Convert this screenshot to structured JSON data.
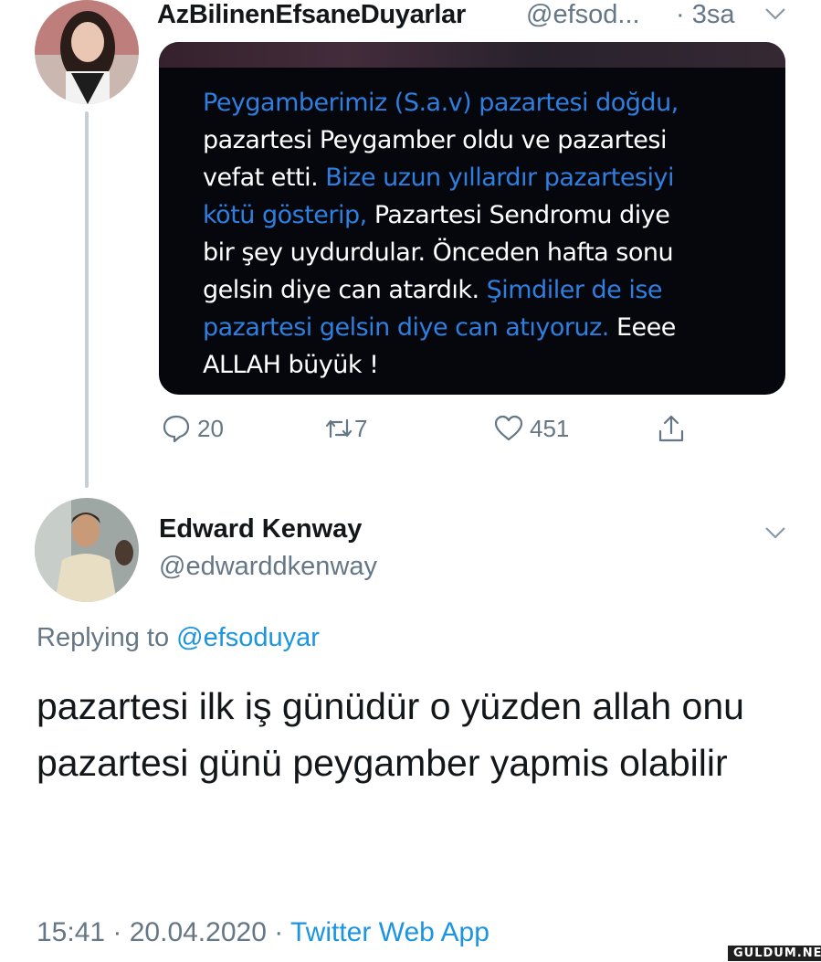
{
  "tweet1": {
    "display_name": "AzBilinenEfsaneDuyarlar",
    "handle": "@efsod...",
    "time": "· 3sa",
    "image_text": {
      "l1": "Peygamberimiz (S.a.v) pazartesi doğdu,",
      "l2": "pazartesi Peygamber oldu ve pazartesi",
      "l3a": "vefat etti. ",
      "l3b": "Bize uzun yıllardır pazartesiyi",
      "l4a": "kötü gösterip, ",
      "l4b": "Pazartesi Sendromu diye",
      "l5": "bir şey uydurdular. Önceden hafta sonu",
      "l6a": "gelsin diye can atardık. ",
      "l6b": "Şimdiler de ise",
      "l7a": "pazartesi gelsin diye can atıyoruz. ",
      "l7b": "Eeee",
      "l8": "ALLAH büyük !"
    },
    "actions": {
      "replies": "20",
      "retweets": "7",
      "likes": "451"
    }
  },
  "tweet2": {
    "display_name": "Edward Kenway",
    "handle": "@edwarddkenway",
    "replying_prefix": "Replying to ",
    "replying_to": "@efsoduyar",
    "text": "pazartesi ilk iş günüdür o yüzden allah onu pazartesi günü peygamber yapmis olabilir",
    "timestamp": "15:41 · 20.04.2020 · ",
    "source": "Twitter Web App"
  },
  "watermark": "GULDUM.NET",
  "colors": {
    "link": "#1b95e0",
    "muted": "#657786",
    "card_highlight": "#2f7fe0"
  }
}
